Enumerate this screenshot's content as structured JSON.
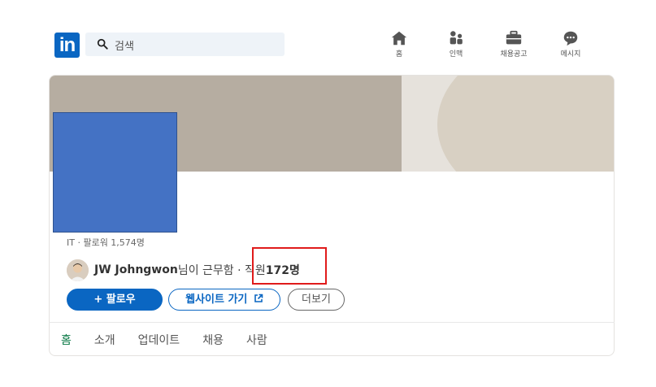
{
  "header": {
    "logo_text": "in",
    "search_placeholder": "검색",
    "nav": [
      {
        "label": "홈",
        "icon": "home-icon"
      },
      {
        "label": "인맥",
        "icon": "people-icon"
      },
      {
        "label": "채용공고",
        "icon": "briefcase-icon"
      },
      {
        "label": "메시지",
        "icon": "message-icon"
      }
    ]
  },
  "company": {
    "meta": "IT · 팔로워 1,574명",
    "employee_person": "JW Johngwon",
    "employee_suffix": " 님이 근무함 · 직원 ",
    "employee_count": "172명"
  },
  "actions": {
    "follow": "+ 팔로우",
    "website": "웹사이트 가기",
    "more": "더보기"
  },
  "tabs": [
    "홈",
    "소개",
    "업데이트",
    "채용",
    "사람"
  ],
  "colors": {
    "brand": "#0a66c2",
    "active_tab": "#057642",
    "highlight": "#e01b1b",
    "logo_placeholder": "#4472c4"
  }
}
